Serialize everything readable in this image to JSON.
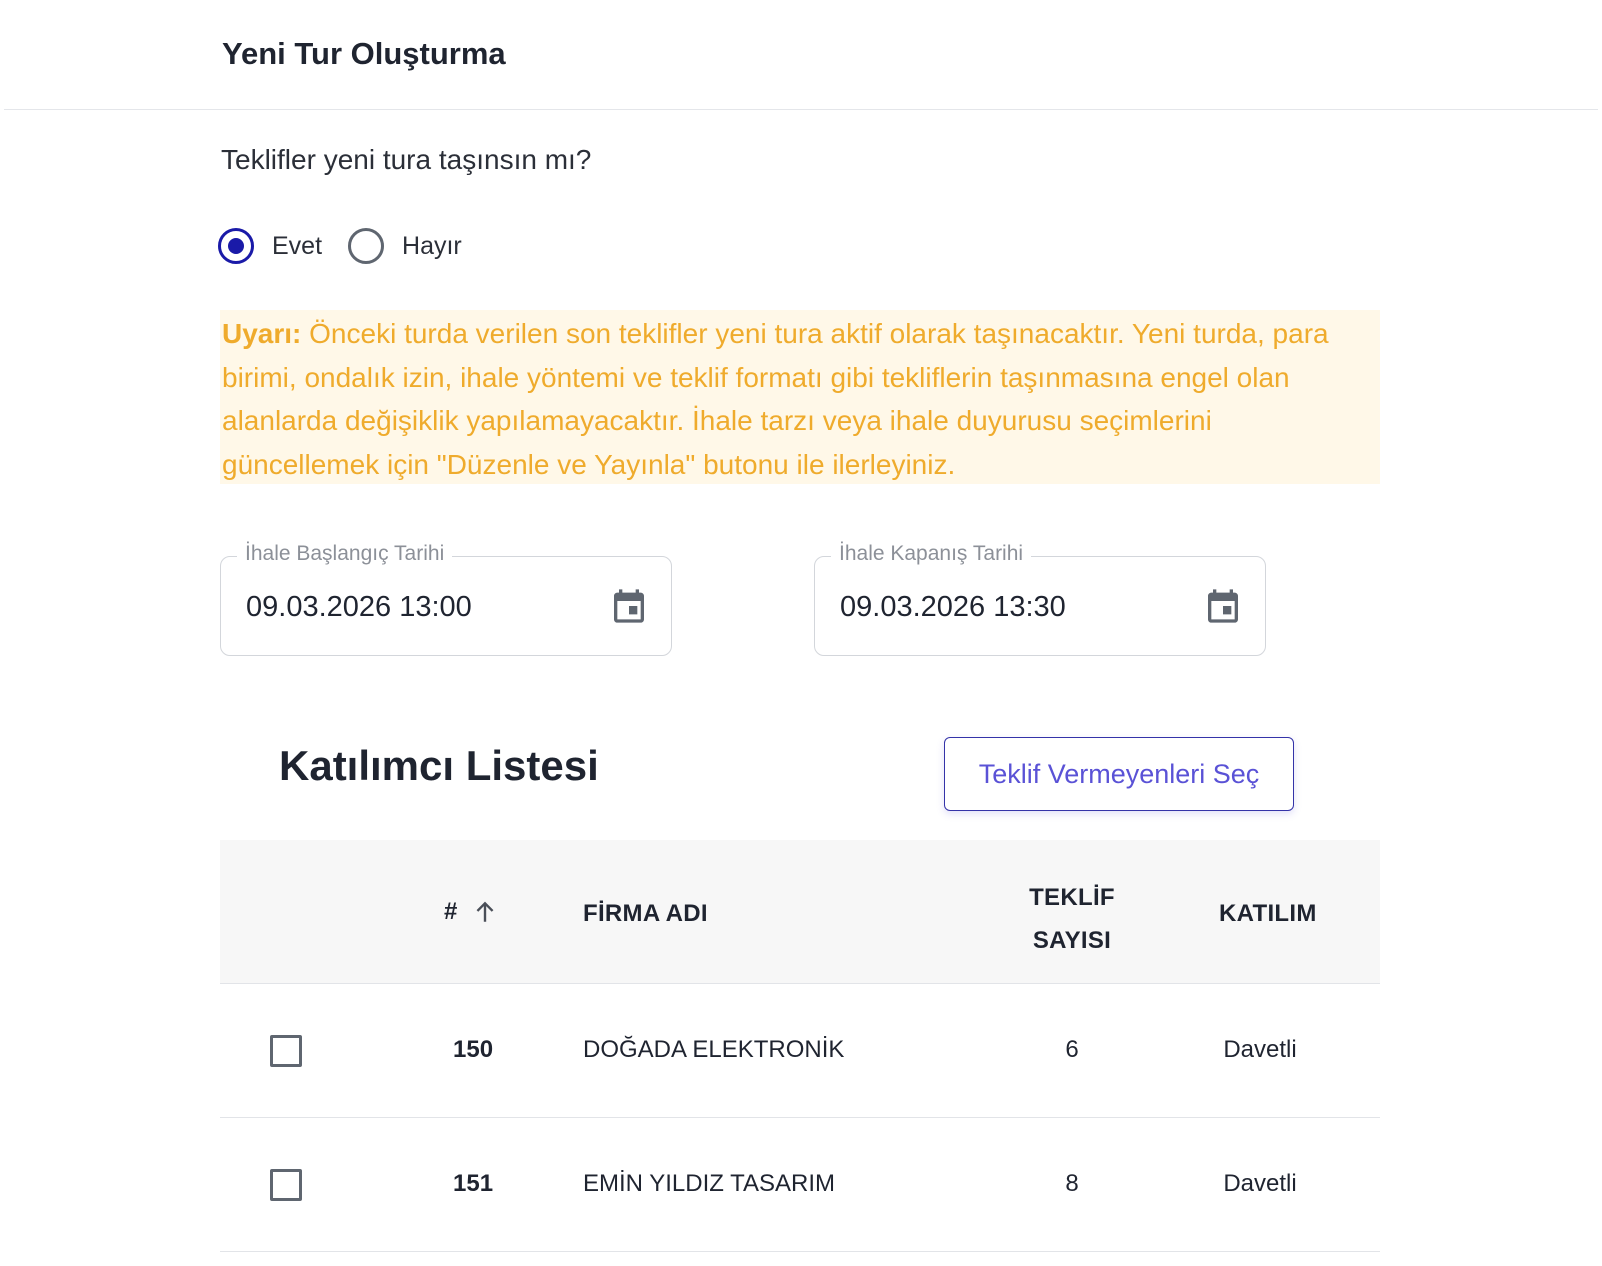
{
  "header": {
    "title": "Yeni Tur Oluşturma"
  },
  "question": "Teklifler yeni tura taşınsın mı?",
  "radio": {
    "options": [
      {
        "label": "Evet",
        "checked": true
      },
      {
        "label": "Hayır",
        "checked": false
      }
    ]
  },
  "warning": {
    "prefix": "Uyarı:",
    "text": " Önceki turda verilen son teklifler yeni tura aktif olarak taşınacaktır. Yeni turda, para birimi, ondalık izin, ihale yöntemi ve teklif formatı gibi tekliflerin taşınmasına engel olan alanlarda değişiklik yapılamayacaktır. İhale tarzı veya ihale duyurusu seçimlerini güncellemek için \"Düzenle ve Yayınla\" butonu ile ilerleyiniz."
  },
  "dates": {
    "start": {
      "label": "İhale Başlangıç Tarihi",
      "value": "09.03.2026 13:00",
      "icon": "calendar-icon"
    },
    "end": {
      "label": "İhale Kapanış Tarihi",
      "value": "09.03.2026 13:30",
      "icon": "calendar-icon"
    }
  },
  "participants": {
    "title": "Katılımcı Listesi",
    "select_button": "Teklif Vermeyenleri Seç",
    "columns": {
      "num": "#",
      "name": "FİRMA ADI",
      "count_line1": "TEKLİF",
      "count_line2": "SAYISI",
      "participation": "KATILIM"
    },
    "rows": [
      {
        "num": "150",
        "name": "DOĞADA ELEKTRONİK",
        "count": "6",
        "participation": "Davetli",
        "checked": false
      },
      {
        "num": "151",
        "name": "EMİN YILDIZ TASARIM",
        "count": "8",
        "participation": "Davetli",
        "checked": false
      }
    ]
  },
  "colors": {
    "primary": "#1a1aa8",
    "button_text": "#5a52d6",
    "warning_text": "#efab2c",
    "warning_bg": "#fff8e8"
  }
}
